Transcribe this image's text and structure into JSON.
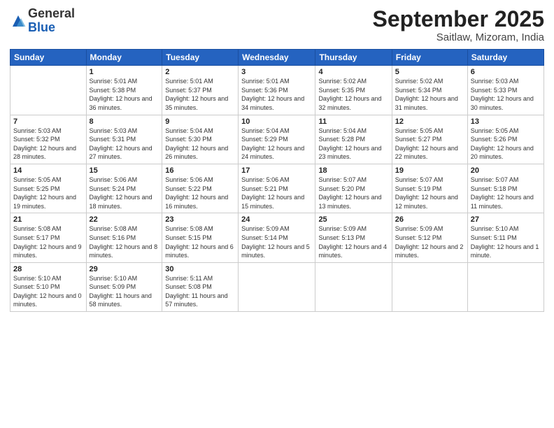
{
  "header": {
    "logo_general": "General",
    "logo_blue": "Blue",
    "month_title": "September 2025",
    "location": "Saitlaw, Mizoram, India"
  },
  "weekdays": [
    "Sunday",
    "Monday",
    "Tuesday",
    "Wednesday",
    "Thursday",
    "Friday",
    "Saturday"
  ],
  "weeks": [
    [
      {
        "day": null
      },
      {
        "day": "1",
        "sunrise": "5:01 AM",
        "sunset": "5:38 PM",
        "daylight": "12 hours and 36 minutes."
      },
      {
        "day": "2",
        "sunrise": "5:01 AM",
        "sunset": "5:37 PM",
        "daylight": "12 hours and 35 minutes."
      },
      {
        "day": "3",
        "sunrise": "5:01 AM",
        "sunset": "5:36 PM",
        "daylight": "12 hours and 34 minutes."
      },
      {
        "day": "4",
        "sunrise": "5:02 AM",
        "sunset": "5:35 PM",
        "daylight": "12 hours and 32 minutes."
      },
      {
        "day": "5",
        "sunrise": "5:02 AM",
        "sunset": "5:34 PM",
        "daylight": "12 hours and 31 minutes."
      },
      {
        "day": "6",
        "sunrise": "5:03 AM",
        "sunset": "5:33 PM",
        "daylight": "12 hours and 30 minutes."
      }
    ],
    [
      {
        "day": "7",
        "sunrise": "5:03 AM",
        "sunset": "5:32 PM",
        "daylight": "12 hours and 28 minutes."
      },
      {
        "day": "8",
        "sunrise": "5:03 AM",
        "sunset": "5:31 PM",
        "daylight": "12 hours and 27 minutes."
      },
      {
        "day": "9",
        "sunrise": "5:04 AM",
        "sunset": "5:30 PM",
        "daylight": "12 hours and 26 minutes."
      },
      {
        "day": "10",
        "sunrise": "5:04 AM",
        "sunset": "5:29 PM",
        "daylight": "12 hours and 24 minutes."
      },
      {
        "day": "11",
        "sunrise": "5:04 AM",
        "sunset": "5:28 PM",
        "daylight": "12 hours and 23 minutes."
      },
      {
        "day": "12",
        "sunrise": "5:05 AM",
        "sunset": "5:27 PM",
        "daylight": "12 hours and 22 minutes."
      },
      {
        "day": "13",
        "sunrise": "5:05 AM",
        "sunset": "5:26 PM",
        "daylight": "12 hours and 20 minutes."
      }
    ],
    [
      {
        "day": "14",
        "sunrise": "5:05 AM",
        "sunset": "5:25 PM",
        "daylight": "12 hours and 19 minutes."
      },
      {
        "day": "15",
        "sunrise": "5:06 AM",
        "sunset": "5:24 PM",
        "daylight": "12 hours and 18 minutes."
      },
      {
        "day": "16",
        "sunrise": "5:06 AM",
        "sunset": "5:22 PM",
        "daylight": "12 hours and 16 minutes."
      },
      {
        "day": "17",
        "sunrise": "5:06 AM",
        "sunset": "5:21 PM",
        "daylight": "12 hours and 15 minutes."
      },
      {
        "day": "18",
        "sunrise": "5:07 AM",
        "sunset": "5:20 PM",
        "daylight": "12 hours and 13 minutes."
      },
      {
        "day": "19",
        "sunrise": "5:07 AM",
        "sunset": "5:19 PM",
        "daylight": "12 hours and 12 minutes."
      },
      {
        "day": "20",
        "sunrise": "5:07 AM",
        "sunset": "5:18 PM",
        "daylight": "12 hours and 11 minutes."
      }
    ],
    [
      {
        "day": "21",
        "sunrise": "5:08 AM",
        "sunset": "5:17 PM",
        "daylight": "12 hours and 9 minutes."
      },
      {
        "day": "22",
        "sunrise": "5:08 AM",
        "sunset": "5:16 PM",
        "daylight": "12 hours and 8 minutes."
      },
      {
        "day": "23",
        "sunrise": "5:08 AM",
        "sunset": "5:15 PM",
        "daylight": "12 hours and 6 minutes."
      },
      {
        "day": "24",
        "sunrise": "5:09 AM",
        "sunset": "5:14 PM",
        "daylight": "12 hours and 5 minutes."
      },
      {
        "day": "25",
        "sunrise": "5:09 AM",
        "sunset": "5:13 PM",
        "daylight": "12 hours and 4 minutes."
      },
      {
        "day": "26",
        "sunrise": "5:09 AM",
        "sunset": "5:12 PM",
        "daylight": "12 hours and 2 minutes."
      },
      {
        "day": "27",
        "sunrise": "5:10 AM",
        "sunset": "5:11 PM",
        "daylight": "12 hours and 1 minute."
      }
    ],
    [
      {
        "day": "28",
        "sunrise": "5:10 AM",
        "sunset": "5:10 PM",
        "daylight": "12 hours and 0 minutes."
      },
      {
        "day": "29",
        "sunrise": "5:10 AM",
        "sunset": "5:09 PM",
        "daylight": "11 hours and 58 minutes."
      },
      {
        "day": "30",
        "sunrise": "5:11 AM",
        "sunset": "5:08 PM",
        "daylight": "11 hours and 57 minutes."
      },
      {
        "day": null
      },
      {
        "day": null
      },
      {
        "day": null
      },
      {
        "day": null
      }
    ]
  ],
  "labels": {
    "sunrise_prefix": "Sunrise: ",
    "sunset_prefix": "Sunset: ",
    "daylight_prefix": "Daylight: "
  }
}
